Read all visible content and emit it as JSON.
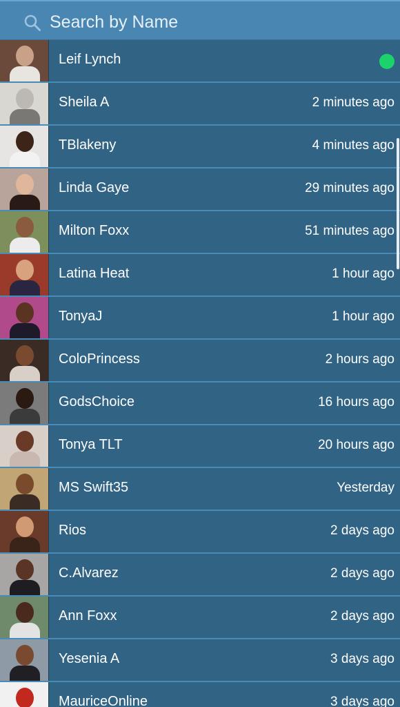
{
  "search": {
    "placeholder": "Search by Name",
    "icon": "search-icon"
  },
  "status_colors": {
    "online": "#1bd36a",
    "row_bg": "#306384",
    "header_bg": "#4a86b2"
  },
  "users": [
    {
      "name": "Leif Lynch",
      "time": "",
      "online": true,
      "avatar": {
        "bg": "#6b4a3c",
        "skin": "#c9a189",
        "shirt": "#e8e4df"
      }
    },
    {
      "name": "Sheila A",
      "time": "2 minutes ago",
      "online": false,
      "avatar": {
        "bg": "#d9d7d2",
        "skin": "#bcb8b2",
        "shirt": "#7a7874"
      }
    },
    {
      "name": "TBlakeny",
      "time": "4 minutes ago",
      "online": false,
      "avatar": {
        "bg": "#e7e5e3",
        "skin": "#3c2418",
        "shirt": "#f2f2f2"
      }
    },
    {
      "name": "Linda Gaye",
      "time": "29 minutes ago",
      "online": false,
      "avatar": {
        "bg": "#b8a49a",
        "skin": "#e1b79c",
        "shirt": "#2a1a16"
      }
    },
    {
      "name": "Milton Foxx",
      "time": "51 minutes ago",
      "online": false,
      "avatar": {
        "bg": "#7d8f5a",
        "skin": "#8a5b3d",
        "shirt": "#ececec"
      }
    },
    {
      "name": "Latina Heat",
      "time": "1 hour ago",
      "online": false,
      "avatar": {
        "bg": "#9a3a2a",
        "skin": "#d7a27d",
        "shirt": "#2a2540"
      }
    },
    {
      "name": "TonyaJ",
      "time": "1 hour ago",
      "online": false,
      "avatar": {
        "bg": "#b04a8a",
        "skin": "#5a3322",
        "shirt": "#1e1a2a"
      }
    },
    {
      "name": "ColoPrincess",
      "time": "2 hours ago",
      "online": false,
      "avatar": {
        "bg": "#3a2b24",
        "skin": "#7a4a30",
        "shirt": "#d8cfc8"
      }
    },
    {
      "name": "GodsChoice",
      "time": "16 hours ago",
      "online": false,
      "avatar": {
        "bg": "#7b7b7b",
        "skin": "#2a1a12",
        "shirt": "#3b3b3b"
      }
    },
    {
      "name": "Tonya TLT",
      "time": "20 hours ago",
      "online": false,
      "avatar": {
        "bg": "#d9cfc9",
        "skin": "#6a3a28",
        "shirt": "#c9b8b0"
      }
    },
    {
      "name": "MS Swift35",
      "time": "Yesterday",
      "online": false,
      "avatar": {
        "bg": "#c1a575",
        "skin": "#7a4a2c",
        "shirt": "#3a2c24"
      }
    },
    {
      "name": "Rios",
      "time": "2 days ago",
      "online": false,
      "avatar": {
        "bg": "#6a3a2a",
        "skin": "#d29a72",
        "shirt": "#3a2318"
      }
    },
    {
      "name": "C.Alvarez",
      "time": "2 days ago",
      "online": false,
      "avatar": {
        "bg": "#a7a6a4",
        "skin": "#5a3526",
        "shirt": "#1e1e22"
      }
    },
    {
      "name": "Ann Foxx",
      "time": "2 days ago",
      "online": false,
      "avatar": {
        "bg": "#6f8a6a",
        "skin": "#4a2a1c",
        "shirt": "#e3e3e3"
      }
    },
    {
      "name": "Yesenia A",
      "time": "3 days ago",
      "online": false,
      "avatar": {
        "bg": "#8e9aa6",
        "skin": "#7a4a30",
        "shirt": "#1f1f24"
      }
    },
    {
      "name": "MauriceOnline",
      "time": "3 days ago",
      "online": false,
      "avatar": {
        "bg": "#f1f1f1",
        "skin": "#c2281e",
        "shirt": "#c2281e"
      }
    }
  ]
}
